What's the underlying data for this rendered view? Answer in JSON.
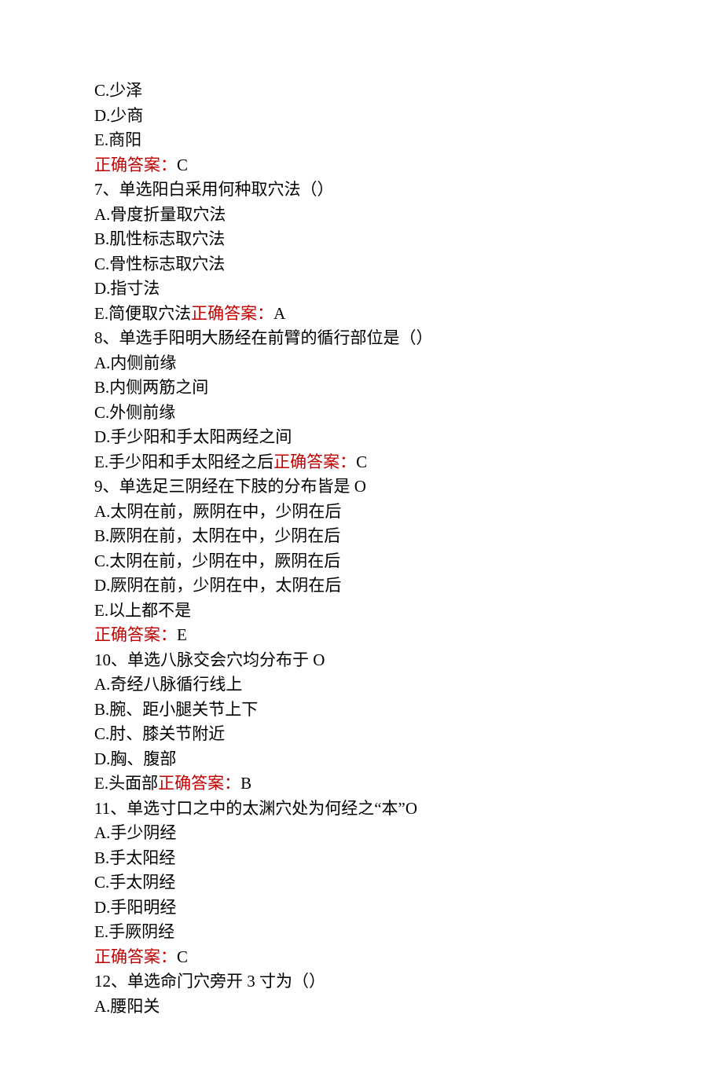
{
  "lines": [
    {
      "text": "C.少泽"
    },
    {
      "text": "D.少商"
    },
    {
      "text": "E.商阳"
    },
    {
      "spans": [
        {
          "text": "正确答案：",
          "red": true
        },
        {
          "text": "C"
        }
      ]
    },
    {
      "text": "7、单选阳白采用何种取穴法（）"
    },
    {
      "text": "A.骨度折量取穴法"
    },
    {
      "text": "B.肌性标志取穴法"
    },
    {
      "text": "C.骨性标志取穴法"
    },
    {
      "text": "D.指寸法"
    },
    {
      "spans": [
        {
          "text": "E.简便取穴法"
        },
        {
          "text": "正确答案：",
          "red": true
        },
        {
          "text": "A"
        }
      ]
    },
    {
      "text": "8、单选手阳明大肠经在前臂的循行部位是（）"
    },
    {
      "text": "A.内侧前缘"
    },
    {
      "text": "B.内侧两筋之间"
    },
    {
      "text": "C.外侧前缘"
    },
    {
      "text": "D.手少阳和手太阳两经之间"
    },
    {
      "spans": [
        {
          "text": "E.手少阳和手太阳经之后"
        },
        {
          "text": "正确答案：",
          "red": true
        },
        {
          "text": "C"
        }
      ]
    },
    {
      "text": "9、单选足三阴经在下肢的分布皆是 O"
    },
    {
      "text": "A.太阴在前，厥阴在中，少阴在后"
    },
    {
      "text": "B.厥阴在前，太阴在中，少阴在后"
    },
    {
      "text": "C.太阴在前，少阴在中，厥阴在后"
    },
    {
      "text": "D.厥阴在前，少阴在中，太阴在后"
    },
    {
      "text": "E.以上都不是"
    },
    {
      "spans": [
        {
          "text": "正确答案：",
          "red": true
        },
        {
          "text": "E"
        }
      ]
    },
    {
      "text": "10、单选八脉交会穴均分布于 O"
    },
    {
      "text": "A.奇经八脉循行线上"
    },
    {
      "text": "B.腕、距小腿关节上下"
    },
    {
      "text": "C.肘、膝关节附近"
    },
    {
      "text": "D.胸、腹部"
    },
    {
      "spans": [
        {
          "text": "E.头面部"
        },
        {
          "text": "正确答案：",
          "red": true
        },
        {
          "text": "B"
        }
      ]
    },
    {
      "text": "11、单选寸口之中的太渊穴处为何经之“本”O"
    },
    {
      "text": "A.手少阴经"
    },
    {
      "text": "B.手太阳经"
    },
    {
      "text": "C.手太阴经"
    },
    {
      "text": "D.手阳明经"
    },
    {
      "text": "E.手厥阴经"
    },
    {
      "spans": [
        {
          "text": "正确答案：",
          "red": true
        },
        {
          "text": "C"
        }
      ]
    },
    {
      "text": "12、单选命门穴旁开 3 寸为（）"
    },
    {
      "text": "A.腰阳关"
    }
  ]
}
